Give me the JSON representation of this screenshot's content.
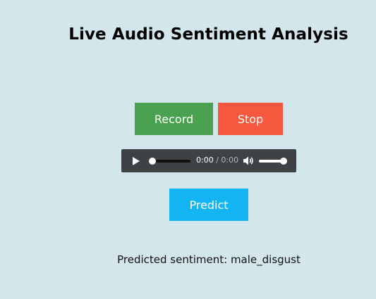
{
  "page": {
    "title": "Live Audio Sentiment Analysis"
  },
  "controls": {
    "record_label": "Record",
    "stop_label": "Stop",
    "predict_label": "Predict"
  },
  "audio_player": {
    "current_time": "0:00",
    "separator": "/",
    "duration": "0:00",
    "icons": {
      "play": "play-icon",
      "volume": "volume-icon"
    },
    "progress_fraction": 0.0,
    "volume_fraction": 1.0
  },
  "result": {
    "text": "Predicted sentiment: male_disgust"
  },
  "colors": {
    "background": "#d3e6ec",
    "record": "#4aa251",
    "stop": "#f5583e",
    "predict": "#15b4f2",
    "player": "#3f4245"
  }
}
